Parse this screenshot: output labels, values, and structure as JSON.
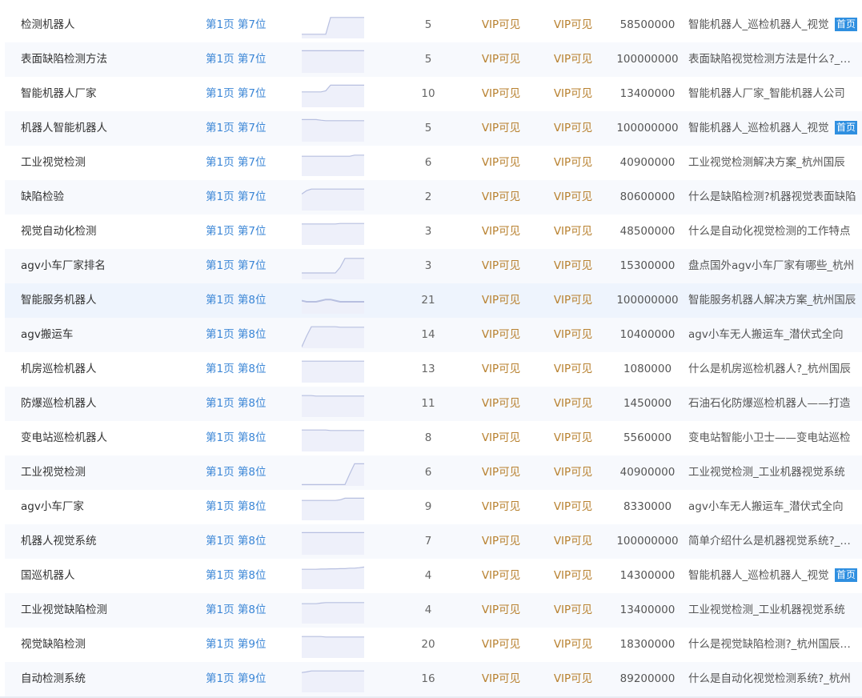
{
  "colors": {
    "rank": "#3b86d6",
    "vip": "#b8812f",
    "badge": "#2f8fe0",
    "trend_line": "#b7bfe0",
    "trend_fill": "#eef0fa"
  },
  "rows": [
    {
      "keyword": "检测机器人",
      "rank": "第1页 第7位",
      "count": "5",
      "vip1": "VIP可见",
      "vip2": "VIP可见",
      "index": "58500000",
      "title": "智能机器人_巡检机器人_视觉",
      "badge": "首页",
      "trend": [
        0.15,
        0.15,
        0.15,
        0.15,
        0.15,
        0.15,
        0.9,
        0.9,
        0.9,
        0.9,
        0.9,
        0.9,
        0.9,
        0.9
      ]
    },
    {
      "keyword": "表面缺陷检测方法",
      "rank": "第1页 第7位",
      "count": "5",
      "vip1": "VIP可见",
      "vip2": "VIP可见",
      "index": "100000000",
      "title": "表面缺陷视觉检测方法是什么?_杭州",
      "badge": "",
      "trend": [
        0.95,
        0.95,
        0.95,
        0.95,
        0.95,
        0.95,
        0.95,
        0.95,
        0.95,
        0.95,
        0.95,
        0.95,
        0.95,
        0.95
      ]
    },
    {
      "keyword": "智能机器人厂家",
      "rank": "第1页 第7位",
      "count": "10",
      "vip1": "VIP可见",
      "vip2": "VIP可见",
      "index": "13400000",
      "title": "智能机器人厂家_智能机器人公司",
      "badge": "",
      "trend": [
        0.65,
        0.65,
        0.65,
        0.65,
        0.65,
        0.7,
        0.95,
        0.95,
        0.95,
        0.95,
        0.95,
        0.95,
        0.95,
        0.95
      ]
    },
    {
      "keyword": "机器人智能机器人",
      "rank": "第1页 第7位",
      "count": "5",
      "vip1": "VIP可见",
      "vip2": "VIP可见",
      "index": "100000000",
      "title": "智能机器人_巡检机器人_视觉",
      "badge": "首页",
      "trend": [
        0.95,
        0.95,
        0.95,
        0.95,
        0.92,
        0.9,
        0.9,
        0.9,
        0.9,
        0.9,
        0.9,
        0.9,
        0.9,
        0.9
      ]
    },
    {
      "keyword": "工业视觉检测",
      "rank": "第1页 第7位",
      "count": "6",
      "vip1": "VIP可见",
      "vip2": "VIP可见",
      "index": "40900000",
      "title": "工业视觉检测解决方案_杭州国辰",
      "badge": "",
      "trend": [
        0.85,
        0.85,
        0.85,
        0.85,
        0.85,
        0.85,
        0.85,
        0.85,
        0.85,
        0.85,
        0.85,
        0.9,
        0.9,
        0.9
      ]
    },
    {
      "keyword": "缺陷检验",
      "rank": "第1页 第7位",
      "count": "2",
      "vip1": "VIP可见",
      "vip2": "VIP可见",
      "index": "80600000",
      "title": "什么是缺陷检测?机器视觉表面缺陷",
      "badge": "",
      "trend": [
        0.7,
        0.85,
        0.92,
        0.92,
        0.92,
        0.92,
        0.92,
        0.92,
        0.92,
        0.92,
        0.92,
        0.92,
        0.92,
        0.92
      ]
    },
    {
      "keyword": "视觉自动化检测",
      "rank": "第1页 第7位",
      "count": "3",
      "vip1": "VIP可见",
      "vip2": "VIP可见",
      "index": "48500000",
      "title": "什么是自动化视觉检测的工作特点",
      "badge": "",
      "trend": [
        0.9,
        0.9,
        0.9,
        0.9,
        0.9,
        0.9,
        0.9,
        0.9,
        0.92,
        0.92,
        0.92,
        0.92,
        0.92,
        0.92
      ]
    },
    {
      "keyword": "agv小车厂家排名",
      "rank": "第1页 第7位",
      "count": "3",
      "vip1": "VIP可见",
      "vip2": "VIP可见",
      "index": "15300000",
      "title": "盘点国外agv小车厂家有哪些_杭州",
      "badge": "",
      "trend": [
        0.25,
        0.25,
        0.25,
        0.25,
        0.25,
        0.25,
        0.25,
        0.25,
        0.5,
        0.9,
        0.9,
        0.9,
        0.9,
        0.9
      ]
    },
    {
      "keyword": "智能服务机器人",
      "rank": "第1页 第8位",
      "count": "21",
      "vip1": "VIP可见",
      "vip2": "VIP可见",
      "index": "100000000",
      "title": "智能服务机器人解决方案_杭州国辰",
      "badge": "",
      "trend": [
        0.55,
        0.5,
        0.5,
        0.5,
        0.55,
        0.6,
        0.6,
        0.55,
        0.5,
        0.5,
        0.5,
        0.5,
        0.5,
        0.5
      ]
    },
    {
      "keyword": "agv搬运车",
      "rank": "第1页 第8位",
      "count": "14",
      "vip1": "VIP可见",
      "vip2": "VIP可见",
      "index": "10400000",
      "title": "agv小车无人搬运车_潜伏式全向",
      "badge": "",
      "trend": [
        0.02,
        0.5,
        0.92,
        0.92,
        0.92,
        0.92,
        0.92,
        0.92,
        0.9,
        0.9,
        0.9,
        0.9,
        0.9,
        0.9
      ]
    },
    {
      "keyword": "机房巡检机器人",
      "rank": "第1页 第8位",
      "count": "13",
      "vip1": "VIP可见",
      "vip2": "VIP可见",
      "index": "1080000",
      "title": "什么是机房巡检机器人?_杭州国辰",
      "badge": "",
      "trend": [
        0.92,
        0.92,
        0.92,
        0.92,
        0.92,
        0.92,
        0.92,
        0.92,
        0.92,
        0.92,
        0.92,
        0.92,
        0.92,
        0.92
      ]
    },
    {
      "keyword": "防爆巡检机器人",
      "rank": "第1页 第8位",
      "count": "11",
      "vip1": "VIP可见",
      "vip2": "VIP可见",
      "index": "1450000",
      "title": "石油石化防爆巡检机器人——打造",
      "badge": "",
      "trend": [
        0.92,
        0.92,
        0.92,
        0.9,
        0.9,
        0.9,
        0.9,
        0.9,
        0.9,
        0.9,
        0.9,
        0.9,
        0.9,
        0.9
      ]
    },
    {
      "keyword": "变电站巡检机器人",
      "rank": "第1页 第8位",
      "count": "8",
      "vip1": "VIP可见",
      "vip2": "VIP可见",
      "index": "5560000",
      "title": "变电站智能小卫士——变电站巡检",
      "badge": "",
      "trend": [
        0.92,
        0.92,
        0.92,
        0.92,
        0.92,
        0.92,
        0.9,
        0.9,
        0.9,
        0.9,
        0.9,
        0.9,
        0.9,
        0.9
      ]
    },
    {
      "keyword": "工业视觉检测",
      "rank": "第1页 第8位",
      "count": "6",
      "vip1": "VIP可见",
      "vip2": "VIP可见",
      "index": "40900000",
      "title": "工业视觉检测_工业机器视觉系统",
      "badge": "",
      "trend": [
        0.02,
        0.02,
        0.02,
        0.02,
        0.02,
        0.02,
        0.02,
        0.02,
        0.02,
        0.02,
        0.5,
        0.95,
        0.95,
        0.95
      ]
    },
    {
      "keyword": "agv小车厂家",
      "rank": "第1页 第8位",
      "count": "9",
      "vip1": "VIP可见",
      "vip2": "VIP可见",
      "index": "8330000",
      "title": "agv小车无人搬运车_潜伏式全向",
      "badge": "",
      "trend": [
        0.85,
        0.85,
        0.85,
        0.85,
        0.85,
        0.85,
        0.85,
        0.85,
        0.88,
        0.95,
        0.95,
        0.95,
        0.95,
        0.95
      ]
    },
    {
      "keyword": "机器人视觉系统",
      "rank": "第1页 第8位",
      "count": "7",
      "vip1": "VIP可见",
      "vip2": "VIP可见",
      "index": "100000000",
      "title": "简单介绍什么是机器视觉系统?_杭州",
      "badge": "",
      "trend": [
        0.95,
        0.95,
        0.95,
        0.95,
        0.95,
        0.95,
        0.95,
        0.95,
        0.95,
        0.95,
        0.95,
        0.95,
        0.95,
        0.95
      ]
    },
    {
      "keyword": "国巡机器人",
      "rank": "第1页 第8位",
      "count": "4",
      "vip1": "VIP可见",
      "vip2": "VIP可见",
      "index": "14300000",
      "title": "智能机器人_巡检机器人_视觉",
      "badge": "首页",
      "trend": [
        0.85,
        0.85,
        0.85,
        0.85,
        0.86,
        0.86,
        0.87,
        0.87,
        0.88,
        0.88,
        0.9,
        0.9,
        0.92,
        0.95
      ]
    },
    {
      "keyword": "工业视觉缺陷检测",
      "rank": "第1页 第8位",
      "count": "4",
      "vip1": "VIP可见",
      "vip2": "VIP可见",
      "index": "13400000",
      "title": "工业视觉检测_工业机器视觉系统",
      "badge": "",
      "trend": [
        0.85,
        0.85,
        0.85,
        0.85,
        0.88,
        0.9,
        0.9,
        0.9,
        0.9,
        0.9,
        0.9,
        0.9,
        0.9,
        0.9
      ]
    },
    {
      "keyword": "视觉缺陷检测",
      "rank": "第1页 第9位",
      "count": "20",
      "vip1": "VIP可见",
      "vip2": "VIP可见",
      "index": "18300000",
      "title": "什么是视觉缺陷检测?_杭州国辰机器人",
      "badge": "",
      "trend": [
        0.92,
        0.92,
        0.92,
        0.92,
        0.92,
        0.9,
        0.9,
        0.9,
        0.9,
        0.9,
        0.9,
        0.9,
        0.9,
        0.9
      ]
    },
    {
      "keyword": "自动检测系统",
      "rank": "第1页 第9位",
      "count": "16",
      "vip1": "VIP可见",
      "vip2": "VIP可见",
      "index": "89200000",
      "title": "什么是自动化视觉检测系统?_杭州",
      "badge": "",
      "trend": [
        0.85,
        0.88,
        0.92,
        0.92,
        0.92,
        0.92,
        0.92,
        0.92,
        0.92,
        0.92,
        0.92,
        0.92,
        0.92,
        0.92
      ]
    }
  ]
}
